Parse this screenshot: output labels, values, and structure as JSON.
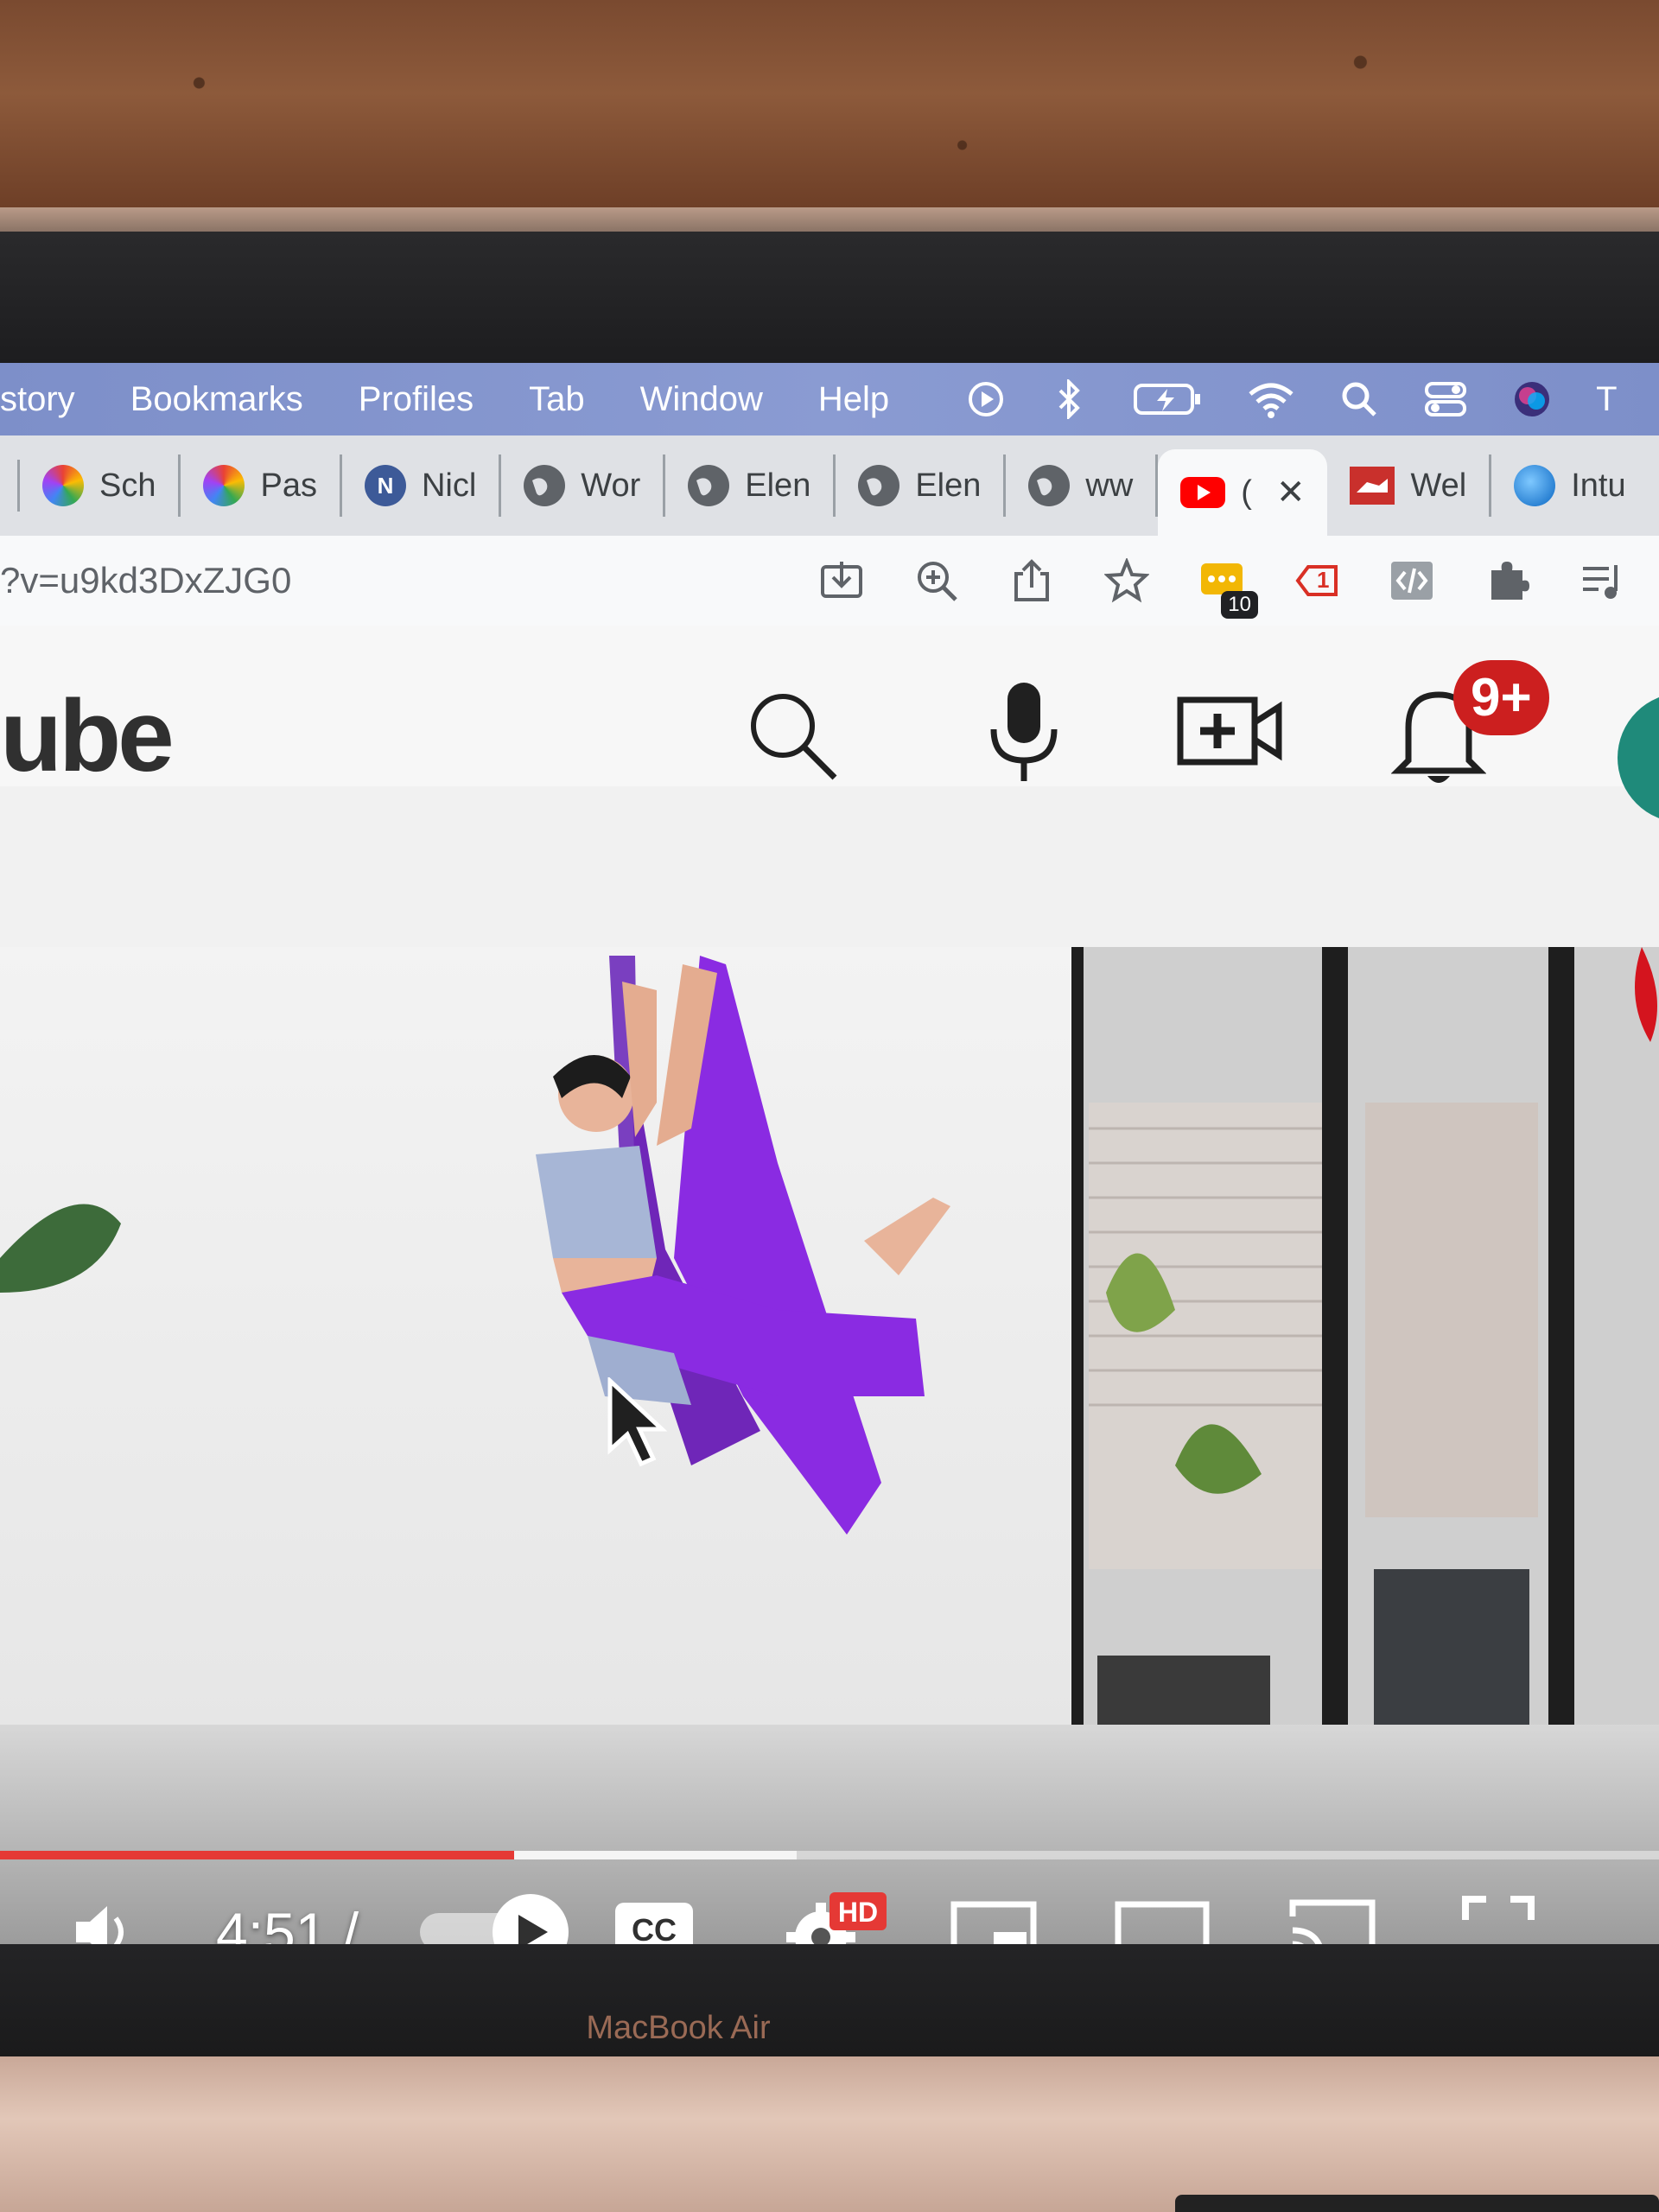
{
  "menubar": {
    "items": [
      "story",
      "Bookmarks",
      "Profiles",
      "Tab",
      "Window",
      "Help"
    ],
    "status_icons": [
      "play-circle-icon",
      "bluetooth-icon",
      "battery-charging-icon",
      "wifi-icon",
      "spotlight-search-icon",
      "control-center-icon",
      "siri-icon"
    ],
    "overflow_letter": "T"
  },
  "tabs": [
    {
      "label": "Sch",
      "favicon": "colorful-flower-icon"
    },
    {
      "label": "Pas",
      "favicon": "colorful-flower-icon"
    },
    {
      "label": "Nicl",
      "favicon": "n-logo-icon"
    },
    {
      "label": "Wor",
      "favicon": "globe-icon"
    },
    {
      "label": "Elen",
      "favicon": "globe-icon"
    },
    {
      "label": "Elen",
      "favicon": "globe-icon"
    },
    {
      "label": "ww",
      "favicon": "globe-icon"
    },
    {
      "label": "(",
      "favicon": "youtube-icon",
      "active": true
    },
    {
      "label": "Wel",
      "favicon": "dog-logo-icon"
    },
    {
      "label": "Intu",
      "favicon": "blue-circle-icon"
    }
  ],
  "tab_close": "✕",
  "address": {
    "url": "?v=u9kd3DxZJG0",
    "extension_badge": "10",
    "tag_badge": "1"
  },
  "youtube": {
    "logo_fragment": "ube",
    "notifications": "9+"
  },
  "player": {
    "current_time": "4:51 /",
    "cc_label": "CC",
    "hd_label": "HD",
    "played_fraction": 0.31,
    "buffered_fraction": 0.48
  },
  "device": {
    "label": "MacBook Air"
  },
  "colors": {
    "youtube_red": "#ff0000",
    "progress_red": "#e53935",
    "menubar": "#8a9bd2",
    "silks_purple": "#8a2be2"
  }
}
